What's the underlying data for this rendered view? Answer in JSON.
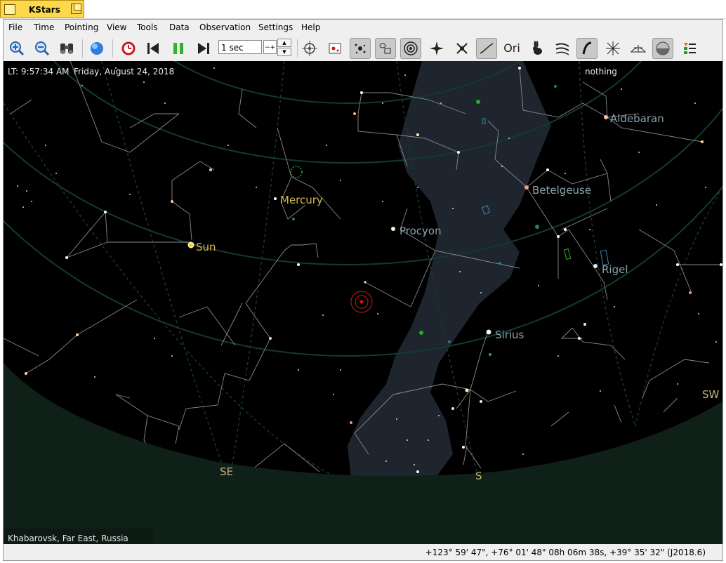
{
  "window": {
    "title": "KStars"
  },
  "menu": [
    "File",
    "Time",
    "Pointing",
    "View",
    "Tools",
    "Data",
    "Observation",
    "Settings",
    "Help"
  ],
  "toolbar": {
    "time_step_value": "1 sec",
    "unit_label": "−+",
    "buttons": [
      {
        "name": "zoom-in",
        "glyph": "⊕"
      },
      {
        "name": "zoom-out",
        "glyph": "⊖"
      },
      {
        "name": "find-object",
        "glyph": "⌕"
      },
      {
        "name": "default-zoom",
        "glyph": "●"
      },
      {
        "name": "set-time-now",
        "glyph": "◷"
      },
      {
        "name": "step-backward",
        "glyph": "⏮"
      },
      {
        "name": "pause",
        "glyph": "❚❚"
      },
      {
        "name": "step-forward",
        "glyph": "⏭"
      },
      {
        "name": "telescope",
        "glyph": "⌖"
      },
      {
        "name": "observation-planner",
        "glyph": "◙"
      },
      {
        "name": "stars",
        "glyph": "✸"
      },
      {
        "name": "deep-sky",
        "glyph": "⌂"
      },
      {
        "name": "solar-system",
        "glyph": "◎"
      },
      {
        "name": "constellation-lines",
        "glyph": "✦"
      },
      {
        "name": "supernovae",
        "glyph": "✧"
      },
      {
        "name": "constellation-art",
        "glyph": "∽"
      },
      {
        "name": "constellation-names",
        "glyph": "Ori"
      },
      {
        "name": "rabbit",
        "glyph": "🐇"
      },
      {
        "name": "milky-way",
        "glyph": "≋"
      },
      {
        "name": "equatorial-grid",
        "glyph": "∫"
      },
      {
        "name": "horizontal-grid",
        "glyph": "✕"
      },
      {
        "name": "ground",
        "glyph": "⌓"
      },
      {
        "name": "horizon",
        "glyph": "◐"
      },
      {
        "name": "hips",
        "glyph": "☰"
      }
    ]
  },
  "sky": {
    "time_text": "LT: 9:57:34 AM",
    "date_text": "Friday, August 24, 2018",
    "focus_text": "nothing",
    "location_text": "Khabarovsk, Far East, Russia",
    "labels": {
      "aldebaran": "Aldebaran",
      "betelgeuse": "Betelgeuse",
      "mercury": "Mercury",
      "procyon": "Procyon",
      "sun": "Sun",
      "rigel": "Rigel",
      "sirius": "Sirius",
      "sw": "SW",
      "se": "SE",
      "s": "S"
    },
    "colors": {
      "sky_background": "#000000",
      "ground": "#0f2018",
      "milky_way": "#1e252f",
      "planet_label": "#d6b84a",
      "star_label": "#8aa4ad",
      "compass_label": "#c4b778",
      "target_marker": "#d01818",
      "grid": "#153a2e"
    }
  },
  "status": {
    "coordinates": "+123° 59' 47\", +76° 01' 48\"  08h 06m 38s, +39° 35' 32\" (J2018.6)"
  }
}
